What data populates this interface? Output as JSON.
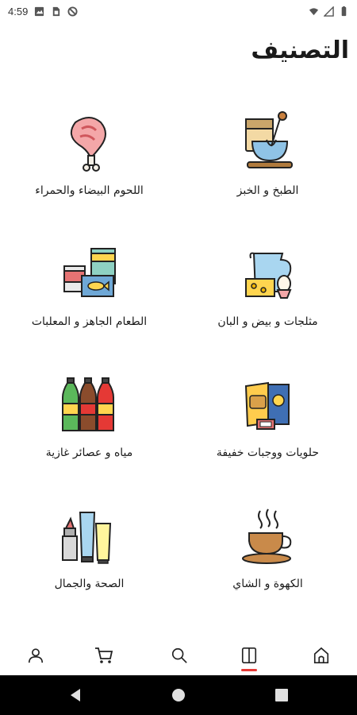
{
  "status_bar": {
    "time": "4:59"
  },
  "header": {
    "title": "التصنيف"
  },
  "categories": [
    {
      "label": "الطبخ و الخبز",
      "icon": "baking-icon"
    },
    {
      "label": "اللحوم البيضاء والحمراء",
      "icon": "meat-icon"
    },
    {
      "label": "مثلجات و بيض و البان",
      "icon": "dairy-icon"
    },
    {
      "label": "الطعام الجاهز و المعلبات",
      "icon": "canned-food-icon"
    },
    {
      "label": "حلويات ووجبات خفيفة",
      "icon": "snacks-icon"
    },
    {
      "label": "مياه و عصائر غازية",
      "icon": "soft-drinks-icon"
    },
    {
      "label": "الكهوة و الشاي",
      "icon": "coffee-tea-icon"
    },
    {
      "label": "الصحة والجمال",
      "icon": "beauty-icon"
    }
  ],
  "bottom_nav": {
    "items": [
      "profile-icon",
      "cart-icon",
      "search-icon",
      "categories-icon",
      "home-icon"
    ],
    "active": "categories-icon",
    "accent": "#e53935"
  }
}
